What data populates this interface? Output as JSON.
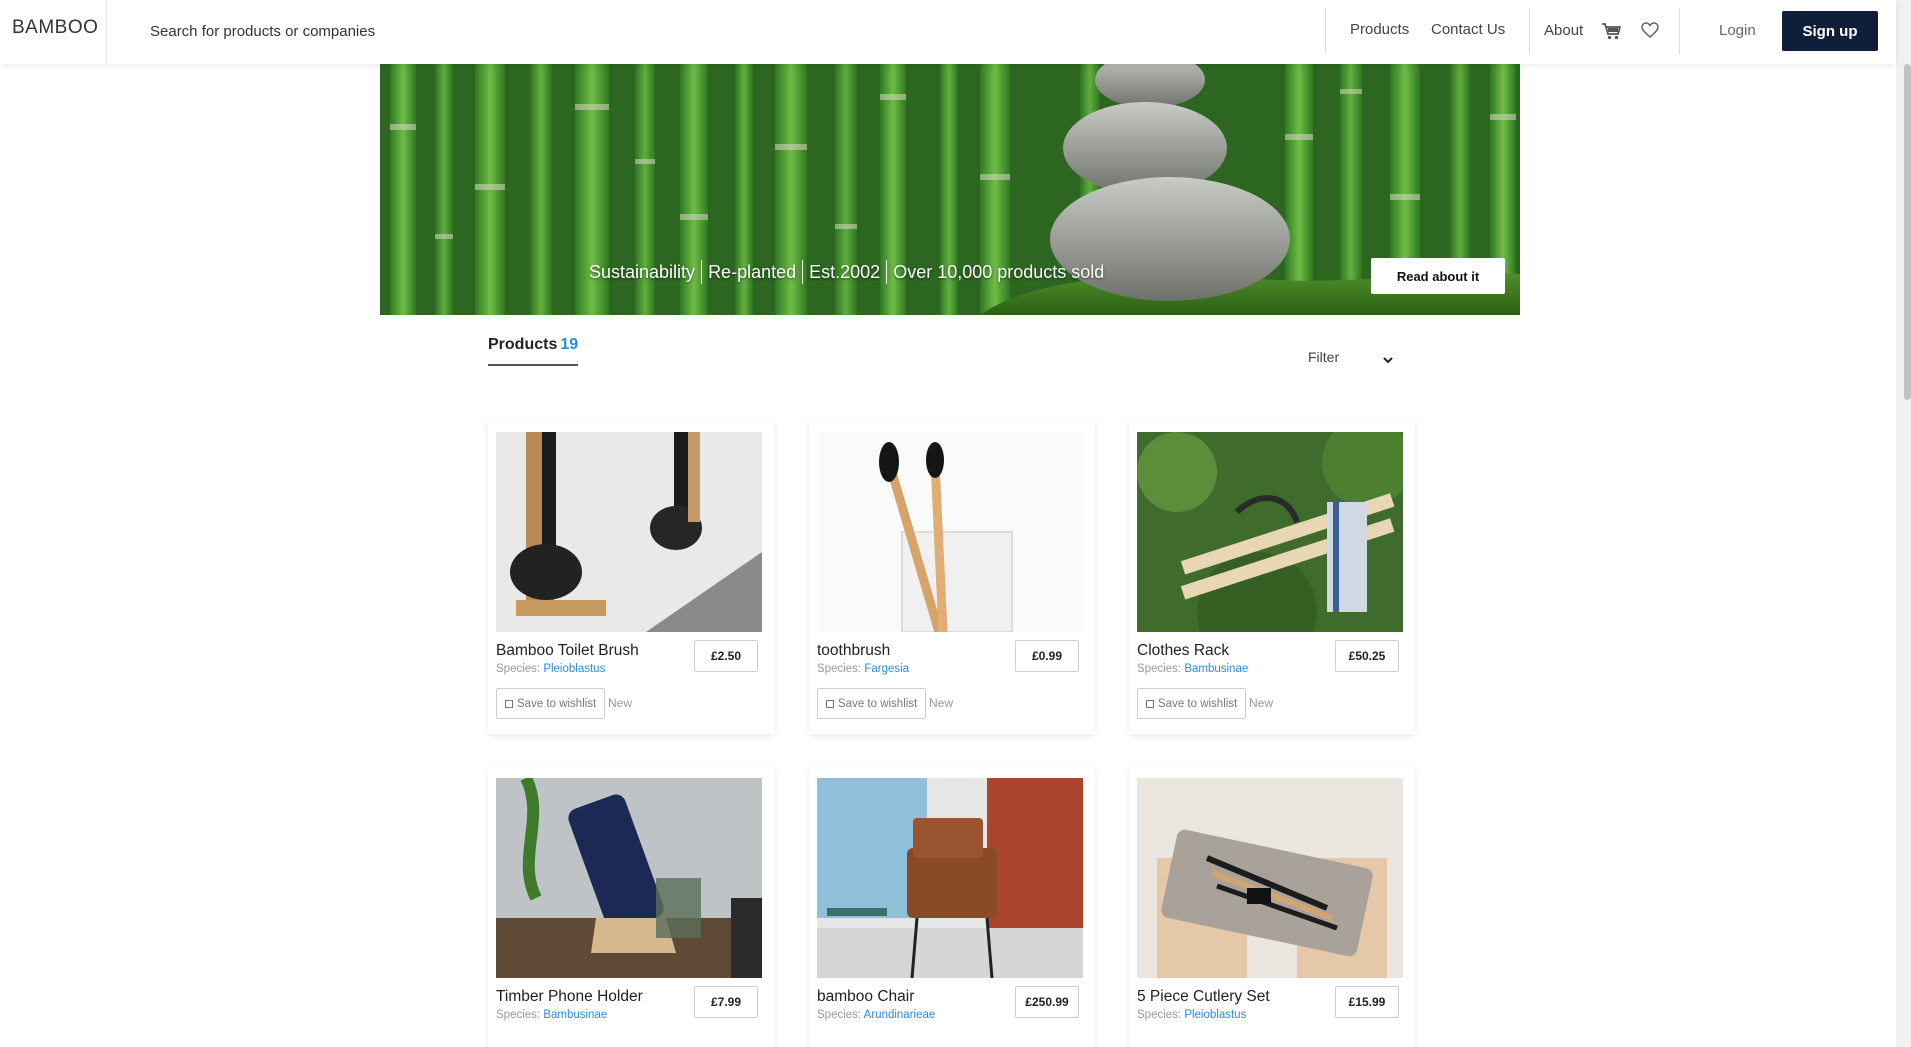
{
  "header": {
    "brand": "BAMBOO",
    "search_placeholder": "Search for products or companies",
    "nav": [
      "Products",
      "Contact Us",
      "About"
    ],
    "cart_icon": "cart-icon",
    "wishlist_icon": "heart-icon",
    "login": "Login",
    "signup": "Sign up"
  },
  "hero": {
    "tags": [
      "Sustainability",
      "Re-planted",
      "Est.2002",
      "Over 10,000 products sold"
    ],
    "read_button": "Read about it"
  },
  "products_section": {
    "heading": "Products",
    "count": "19",
    "filter_label": "Filter"
  },
  "species_prefix": "Species: ",
  "wishlist_label": "Save to wishlist",
  "colors": {
    "accent": "#2e8ad8",
    "signup_bg": "#0f1f3a"
  },
  "products": [
    {
      "name": "Bamboo Toilet Brush",
      "species": "Pleioblastus",
      "price": "£2.50",
      "badge": "New"
    },
    {
      "name": "toothbrush",
      "species": "Fargesia",
      "price": "£0.99",
      "badge": "New"
    },
    {
      "name": "Clothes Rack",
      "species": "Bambusinae",
      "price": "£50.25",
      "badge": "New"
    },
    {
      "name": "Timber Phone Holder",
      "species": "Bambusinae",
      "price": "£7.99",
      "badge": ""
    },
    {
      "name": "bamboo Chair",
      "species": "Arundinarieae",
      "price": "£250.99",
      "badge": ""
    },
    {
      "name": "5 Piece Cutlery Set",
      "species": "Pleioblastus",
      "price": "£15.99",
      "badge": ""
    }
  ]
}
